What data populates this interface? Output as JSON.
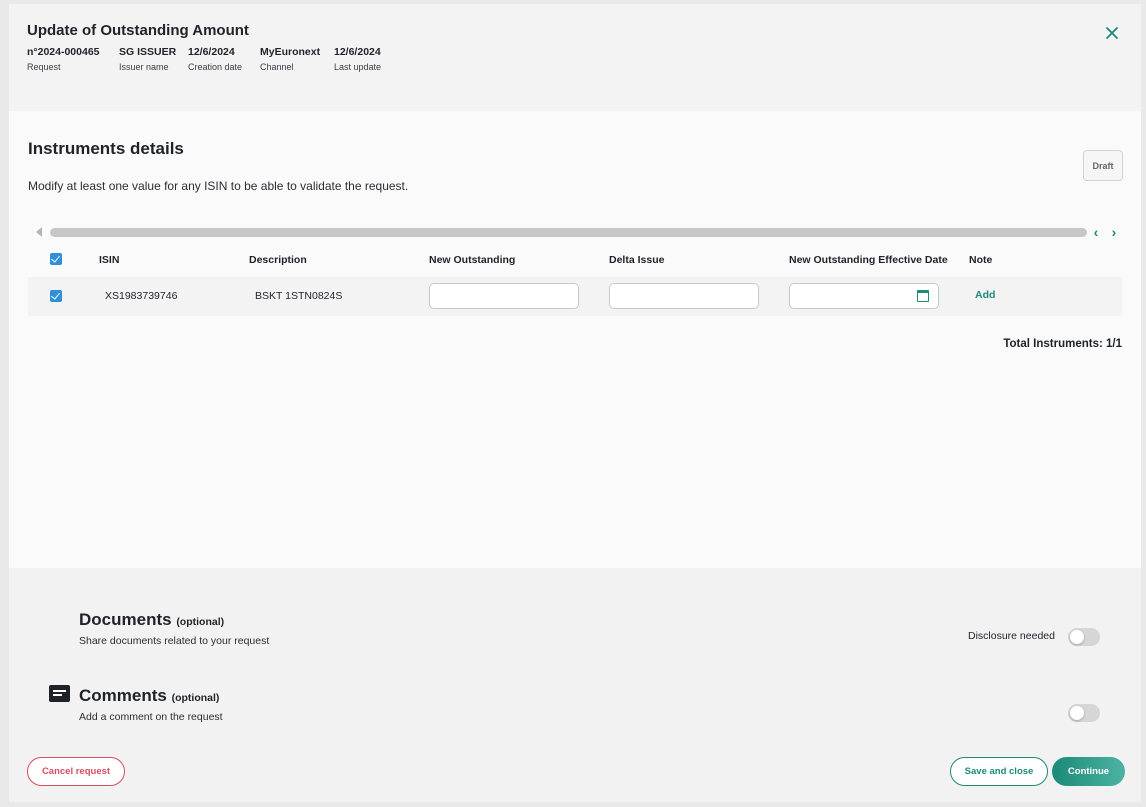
{
  "header": {
    "title": "Update of Outstanding Amount",
    "meta": [
      {
        "value": "n°2024-000465",
        "label": "Request"
      },
      {
        "value": "SG ISSUER",
        "label": "Issuer name"
      },
      {
        "value": "12/6/2024",
        "label": "Creation date"
      },
      {
        "value": "MyEuronext",
        "label": "Channel"
      },
      {
        "value": "12/6/2024",
        "label": "Last update"
      }
    ],
    "close_icon": "close-icon"
  },
  "instruments": {
    "title": "Instruments details",
    "subtitle": "Modify at least one value for any ISIN to be able to validate the request.",
    "draft_label": "Draft",
    "columns": [
      "ISIN",
      "Description",
      "New Outstanding",
      "Delta Issue",
      "New Outstanding Effective Date",
      "Note"
    ],
    "rows": [
      {
        "isin": "XS1983739746",
        "description": "BSKT 1STN0824S",
        "new_outstanding": "",
        "delta_issue": "",
        "effective_date": "",
        "note_action": "Add",
        "checked": true
      }
    ],
    "total": "Total Instruments: 1/1"
  },
  "documents": {
    "title": "Documents",
    "optional": "(optional)",
    "subtitle": "Share documents related to your request",
    "disclosure_label": "Disclosure needed",
    "disclosure_on": false
  },
  "comments": {
    "title": "Comments",
    "optional": "(optional)",
    "subtitle": "Add a comment on the request",
    "toggle_on": false,
    "icon": "comment-icon"
  },
  "footer": {
    "cancel_label": "Cancel request",
    "save_label": "Save and close",
    "continue_label": "Continue"
  },
  "colors": {
    "accent": "#1d8a7a",
    "danger": "#d84e62",
    "checkbox": "#2f8fd8"
  }
}
